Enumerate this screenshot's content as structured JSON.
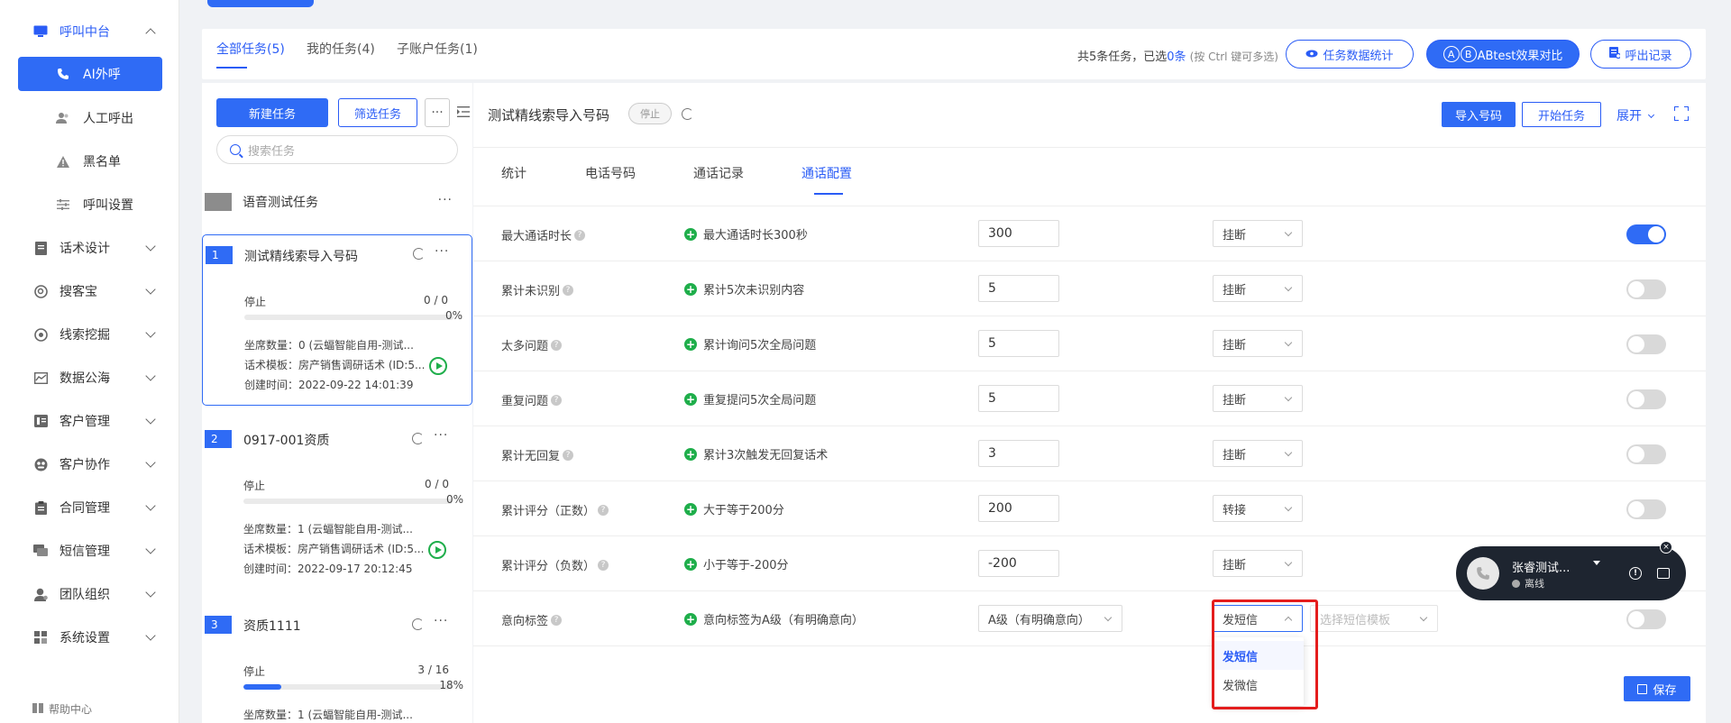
{
  "sidebar": {
    "header": "呼叫中台",
    "sub_items": [
      "AI外呼",
      "人工呼出",
      "黑名单",
      "呼叫设置"
    ],
    "items": [
      "话术设计",
      "搜客宝",
      "线索挖掘",
      "数据公海",
      "客户管理",
      "客户协作",
      "合同管理",
      "短信管理",
      "团队组织",
      "系统设置"
    ],
    "help": "帮助中心"
  },
  "topbar": {
    "tabs": [
      "全部任务(5)",
      "我的任务(4)",
      "子账户任务(1)"
    ],
    "summary_prefix": "共5条任务，已选",
    "summary_selected": "0条",
    "summary_hint": "(按 Ctrl 键可多选)",
    "btn_stats": "任务数据统计",
    "btn_ab_a": "A",
    "btn_ab_b": "B",
    "btn_ab": "ABtest效果对比",
    "btn_records": "呼出记录"
  },
  "tasklist": {
    "new_task": "新建任务",
    "filter_task": "筛选任务",
    "more": "···",
    "search_placeholder": "搜索任务",
    "group_name": "语音测试任务",
    "tasks": [
      {
        "num": "1",
        "name": "测试精线索导入号码",
        "status": "停止",
        "count": "0 / 0",
        "progress": 0,
        "pct": "0%",
        "seats": "坐席数量：0 (云蝠智能自用-测试...",
        "script": "话术模板：房产销售调研话术 (ID:5...",
        "created": "创建时间：2022-09-22 14:01:39"
      },
      {
        "num": "2",
        "name": "0917-001资质",
        "status": "停止",
        "count": "0 / 0",
        "progress": 0,
        "pct": "0%",
        "seats": "坐席数量：1 (云蝠智能自用-测试...",
        "script": "话术模板：房产销售调研话术 (ID:5...",
        "created": "创建时间：2022-09-17 20:12:45"
      },
      {
        "num": "3",
        "name": "资质1111",
        "status": "停止",
        "count": "3 / 16",
        "progress": 0.18,
        "pct": "18%",
        "seats": "坐席数量：1 (云蝠智能自用-测试..."
      }
    ]
  },
  "detail": {
    "title": "测试精线索导入号码",
    "status_badge": "停止",
    "btn_import": "导入号码",
    "btn_start": "开始任务",
    "expand": "展开",
    "tabs": [
      "统计",
      "电话号码",
      "通话记录",
      "通话配置"
    ],
    "rows": [
      {
        "label": "最大通话时长",
        "rule": "最大通话时长300秒",
        "value": "300",
        "action": "挂断",
        "enabled": true
      },
      {
        "label": "累计未识别",
        "rule": "累计5次未识别内容",
        "value": "5",
        "action": "挂断",
        "enabled": false
      },
      {
        "label": "太多问题",
        "rule": "累计询问5次全局问题",
        "value": "5",
        "action": "挂断",
        "enabled": false
      },
      {
        "label": "重复问题",
        "rule": "重复提问5次全局问题",
        "value": "5",
        "action": "挂断",
        "enabled": false
      },
      {
        "label": "累计无回复",
        "rule": "累计3次触发无回复话术",
        "value": "3",
        "action": "挂断",
        "enabled": false
      },
      {
        "label": "累计评分（正数）",
        "rule": "大于等于200分",
        "value": "200",
        "action": "转接",
        "enabled": false
      },
      {
        "label": "累计评分（负数）",
        "rule": "小于等于-200分",
        "value": "-200",
        "action": "挂断",
        "enabled": false
      }
    ],
    "intent_row": {
      "label": "意向标签",
      "rule": "意向标签为A级（有明确意向）",
      "level": "A级（有明确意向）",
      "action": "发短信",
      "template_placeholder": "选择短信模板",
      "enabled": false
    },
    "dropdown_options": [
      "发短信",
      "发微信"
    ],
    "save": "保存"
  },
  "call_widget": {
    "name": "张睿测试...",
    "status": "离线"
  },
  "colors": {
    "accent": "#2f6bf5",
    "highlight": "#e41d1d",
    "success": "#1fae4b",
    "widget_bg": "#1e2530"
  }
}
